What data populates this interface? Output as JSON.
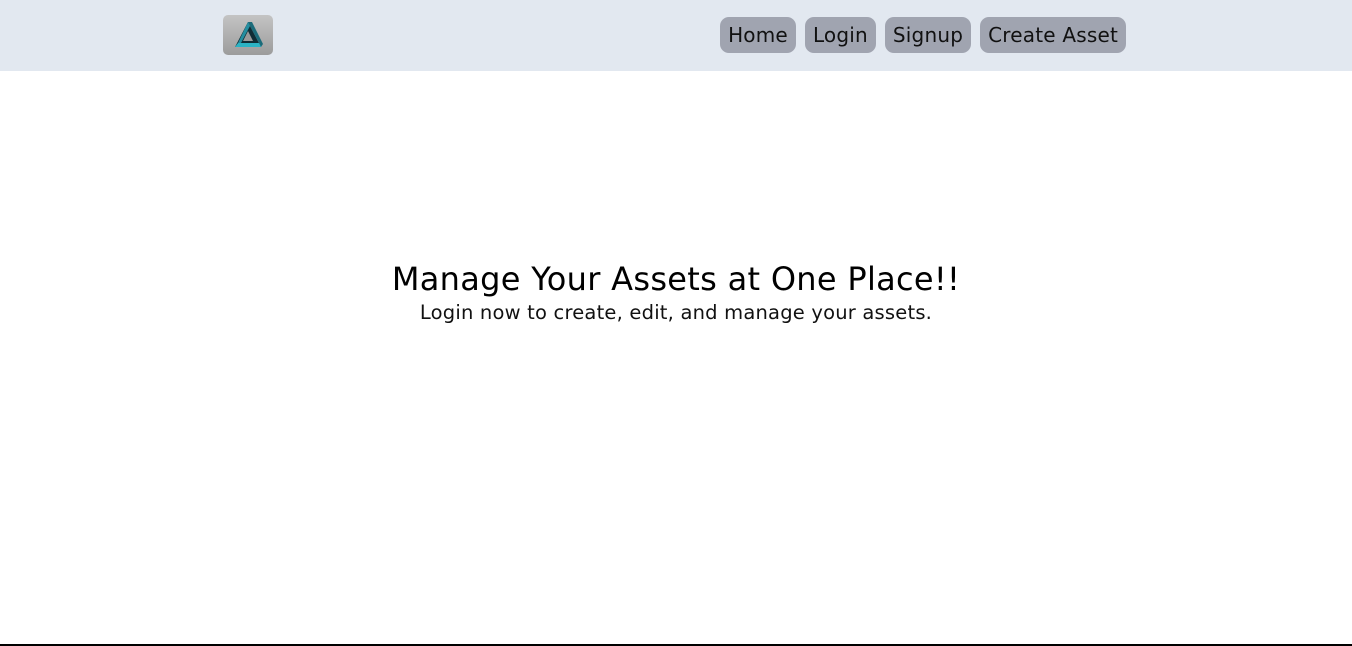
{
  "navbar": {
    "logo_icon": "impossible-triangle-logo-icon",
    "links": [
      {
        "label": "Home"
      },
      {
        "label": "Login"
      },
      {
        "label": "Signup"
      },
      {
        "label": "Create Asset"
      }
    ]
  },
  "hero": {
    "title": "Manage Your Assets at One Place!!",
    "subtitle": "Login now to create, edit, and manage your assets."
  },
  "colors": {
    "navbar_background": "#e2e8f0",
    "nav_button_background": "#a0a4b0",
    "logo_accent": "#2bb3c4"
  }
}
